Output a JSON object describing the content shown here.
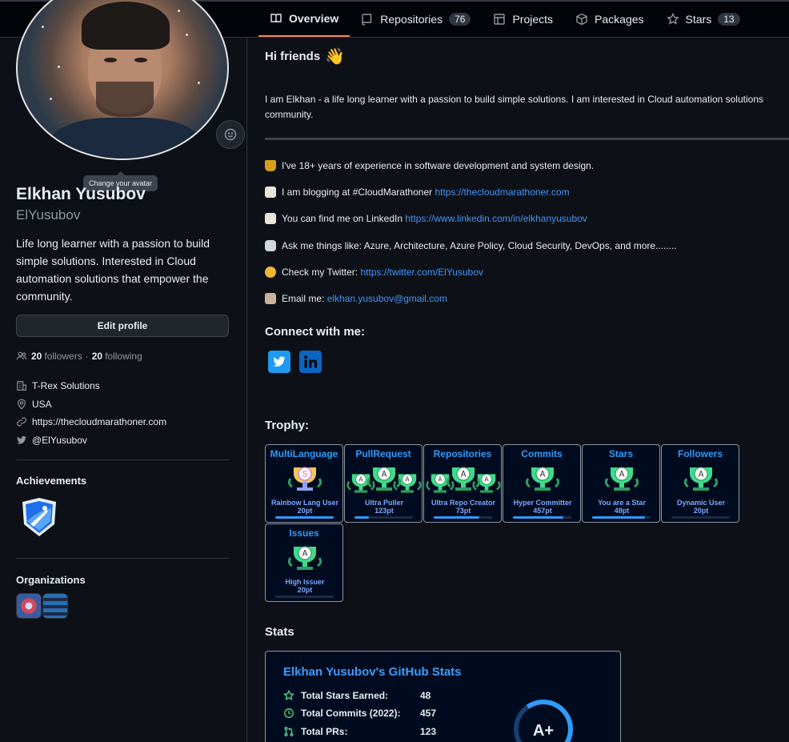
{
  "tabs": [
    {
      "label": "Overview",
      "icon": "book-icon"
    },
    {
      "label": "Repositories",
      "icon": "repo-icon",
      "count": "76"
    },
    {
      "label": "Projects",
      "icon": "table-icon"
    },
    {
      "label": "Packages",
      "icon": "package-icon"
    },
    {
      "label": "Stars",
      "icon": "star-icon",
      "count": "13"
    }
  ],
  "profile": {
    "tooltip": "Change your avatar",
    "fullname": "Elkhan Yusubov",
    "username": "ElYusubov",
    "bio": "Life long learner with a passion to build simple solutions. Interested in Cloud automation solutions that empower the community.",
    "edit_label": "Edit profile",
    "followers": "20",
    "followers_label": "followers",
    "dot": "·",
    "following": "20",
    "following_label": "following",
    "company": "T-Rex Solutions",
    "location": "USA",
    "website": "https://thecloudmarathoner.com",
    "twitter": "@ElYusubov",
    "achievements_title": "Achievements",
    "organizations_title": "Organizations"
  },
  "readme": {
    "greeting": "Hi friends",
    "intro_1": "I am Elkhan - a life long learner with a passion to build simple solutions. I am interested in Cloud automation solutions",
    "intro_2": "community.",
    "items": [
      {
        "text": "I've 18+ years of experience in software development and system design.",
        "link": ""
      },
      {
        "text": "I am blogging at #CloudMarathoner ",
        "link": "https://thecloudmarathoner.com"
      },
      {
        "text": "You can find me on LinkedIn ",
        "link": "https://www.linkedin.com/in/elkhanyusubov"
      },
      {
        "text": "Ask me things like: Azure, Architecture, Azure Policy, Cloud Security, DevOps, and more........",
        "link": ""
      },
      {
        "text": "Check my Twitter: ",
        "link": "https://twitter.com/ElYusubov"
      },
      {
        "text": "Email me: ",
        "link": "elkhan.yusubov@gmail.com"
      }
    ],
    "connect_title": "Connect with me:",
    "trophy_title": "Trophy:",
    "stats_title": "Stats"
  },
  "trophies": [
    {
      "title": "MultiLanguage",
      "rank": "S",
      "label": "Rainbow Lang User",
      "points": "20pt",
      "progress": 1.0
    },
    {
      "title": "PullRequest",
      "rank": "A",
      "label": "Ultra Puller",
      "points": "123pt",
      "progress": 0.25
    },
    {
      "title": "Repositories",
      "rank": "A",
      "label": "Ultra Repo Creator",
      "points": "73pt",
      "progress": 0.78
    },
    {
      "title": "Commits",
      "rank": "A",
      "label": "Hyper Committer",
      "points": "457pt",
      "progress": 0.86
    },
    {
      "title": "Stars",
      "rank": "A",
      "label": "You are a Star",
      "points": "48pt",
      "progress": 0.9
    },
    {
      "title": "Followers",
      "rank": "A",
      "label": "Dynamic User",
      "points": "20pt",
      "progress": 0.0
    },
    {
      "title": "Issues",
      "rank": "A",
      "label": "High Issuer",
      "points": "20pt",
      "progress": 0.0
    }
  ],
  "stats": {
    "title": "Elkhan Yusubov's GitHub Stats",
    "rows": [
      {
        "label": "Total Stars Earned:",
        "value": "48",
        "icon": "star-icon"
      },
      {
        "label": "Total Commits (2022):",
        "value": "457",
        "icon": "history-icon"
      },
      {
        "label": "Total PRs:",
        "value": "123",
        "icon": "pr-icon"
      }
    ],
    "grade": "A+"
  },
  "colors": {
    "accent": "#4493f8",
    "tab_underline": "#f78166",
    "trophy_title": "#2f9bfb",
    "stats_icon": "#4ad08a"
  }
}
